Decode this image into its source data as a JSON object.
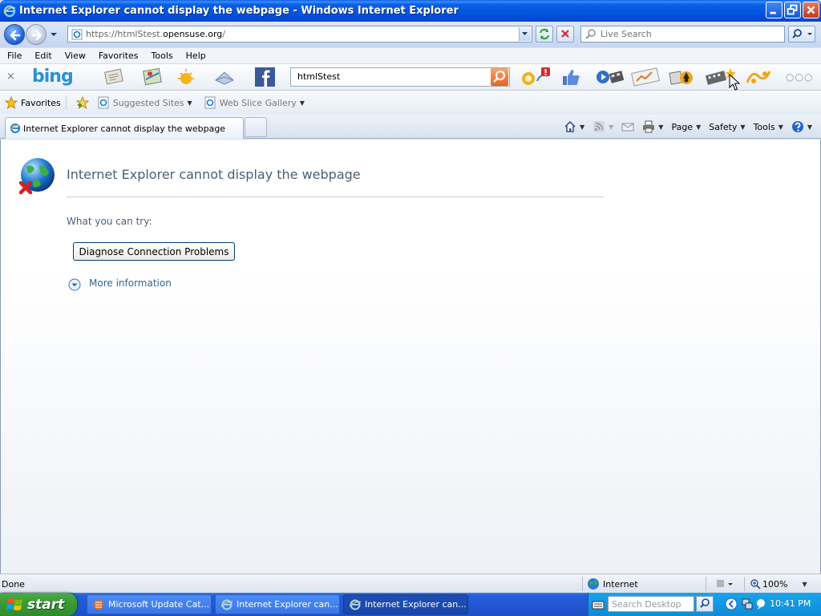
{
  "window": {
    "title": "Internet Explorer cannot display the webpage - Windows Internet Explorer"
  },
  "address_bar": {
    "url_prefix": "https://htmlStest.",
    "url_domain": "opensuse.org",
    "url_suffix": "/"
  },
  "search": {
    "placeholder": "Live Search"
  },
  "menu": {
    "items": [
      "File",
      "Edit",
      "View",
      "Favorites",
      "Tools",
      "Help"
    ]
  },
  "bing_toolbar": {
    "logo_text": "bing",
    "query": "htmlStest",
    "close_glyph": "×",
    "more_glyph": "○○○"
  },
  "favorites_bar": {
    "favorites_label": "Favorites",
    "suggested_sites": "Suggested Sites",
    "web_slice_gallery": "Web Slice Gallery"
  },
  "tabs": [
    {
      "label": "Internet Explorer cannot display the webpage"
    }
  ],
  "command_bar": {
    "page": "Page",
    "safety": "Safety",
    "tools": "Tools"
  },
  "content": {
    "title": "Internet Explorer cannot display the webpage",
    "try_label": "What you can try:",
    "diagnose_button": "Diagnose Connection Problems",
    "more_info": "More information"
  },
  "status_bar": {
    "status": "Done",
    "zone": "Internet",
    "zoom": "100%"
  },
  "taskbar": {
    "start_label": "start",
    "tasks": [
      {
        "label": "Microsoft Update Cat..."
      },
      {
        "label": "Internet Explorer can..."
      },
      {
        "label": "Internet Explorer can..."
      }
    ],
    "desktop_search_placeholder": "Search Desktop",
    "clock": "10:41 PM"
  },
  "colors": {
    "title_bar": "#0a5fe6",
    "error_text": "#4b5e77",
    "link": "#336699",
    "start_green": "#3c9c37",
    "tray_blue": "#0f8bd8"
  }
}
